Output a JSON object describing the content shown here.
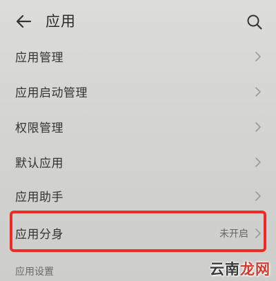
{
  "header": {
    "title": "应用",
    "back_icon": "back-arrow-icon",
    "search_icon": "search-icon"
  },
  "menu": {
    "items": [
      {
        "label": "应用管理"
      },
      {
        "label": "应用启动管理"
      },
      {
        "label": "权限管理"
      },
      {
        "label": "默认应用"
      },
      {
        "label": "应用助手"
      },
      {
        "label": "应用分身",
        "status": "未开启"
      }
    ],
    "highlight_color": "#ee2a24"
  },
  "section": {
    "label": "应用设置"
  },
  "watermark": {
    "part1": "云南",
    "part2": "龙网"
  }
}
